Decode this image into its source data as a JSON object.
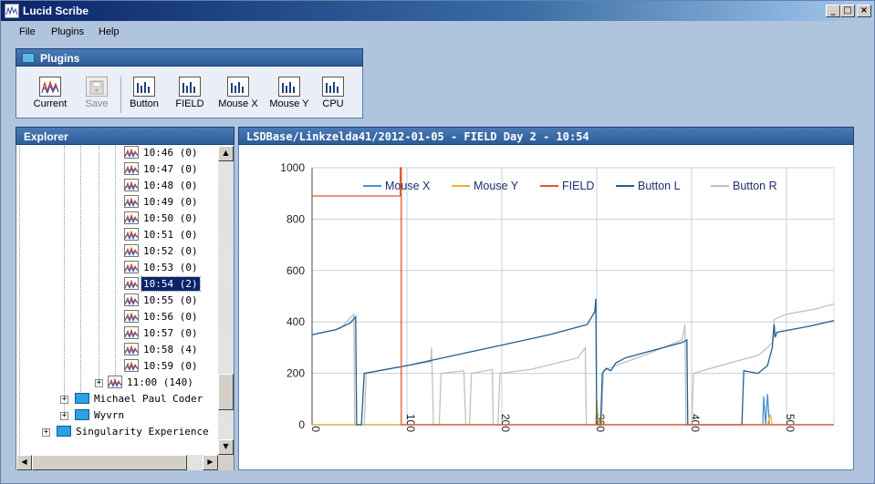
{
  "window": {
    "title": "Lucid Scribe"
  },
  "menu": [
    {
      "label": "File"
    },
    {
      "label": "Plugins"
    },
    {
      "label": "Help"
    }
  ],
  "plugins_panel": {
    "title": "Plugins",
    "buttons": [
      {
        "label": "Current",
        "icon": "waveform-icon",
        "enabled": true
      },
      {
        "label": "Save",
        "icon": "save-disk-icon",
        "enabled": false
      },
      {
        "label": "Button",
        "icon": "signal-bars-icon",
        "enabled": true
      },
      {
        "label": "FIELD",
        "icon": "signal-bars-icon",
        "enabled": true
      },
      {
        "label": "Mouse X",
        "icon": "signal-bars-icon",
        "enabled": true
      },
      {
        "label": "Mouse Y",
        "icon": "signal-bars-icon",
        "enabled": true
      },
      {
        "label": "CPU",
        "icon": "signal-bars-icon",
        "enabled": true
      }
    ]
  },
  "explorer": {
    "title": "Explorer",
    "items": [
      {
        "label": "10:46 (0)",
        "type": "session"
      },
      {
        "label": "10:47 (0)",
        "type": "session"
      },
      {
        "label": "10:48 (0)",
        "type": "session"
      },
      {
        "label": "10:49 (0)",
        "type": "session"
      },
      {
        "label": "10:50 (0)",
        "type": "session"
      },
      {
        "label": "10:51 (0)",
        "type": "session"
      },
      {
        "label": "10:52 (0)",
        "type": "session"
      },
      {
        "label": "10:53 (0)",
        "type": "session"
      },
      {
        "label": "10:54 (2)",
        "type": "session",
        "selected": true
      },
      {
        "label": "10:55 (0)",
        "type": "session"
      },
      {
        "label": "10:56 (0)",
        "type": "session"
      },
      {
        "label": "10:57 (0)",
        "type": "session"
      },
      {
        "label": "10:58 (4)",
        "type": "session"
      },
      {
        "label": "10:59 (0)",
        "type": "session"
      },
      {
        "label": "11:00 (140)",
        "type": "session-collapsed"
      },
      {
        "label": "Michael Paul Coder",
        "type": "folder"
      },
      {
        "label": "Wyvrn",
        "type": "folder"
      },
      {
        "label": "Singularity Experience",
        "type": "root-folder"
      }
    ]
  },
  "chart_panel": {
    "title": "LSDBase/Linkzelda41/2012-01-05 - FIELD Day 2 - 10:54"
  },
  "colors": {
    "mouse_x": "#4a8fd6",
    "mouse_y": "#f0b030",
    "field": "#e8542a",
    "button_l": "#1f5f96",
    "button_r": "#c0c0c0"
  },
  "chart_data": {
    "type": "line",
    "xlim": [
      0,
      550
    ],
    "ylim": [
      0,
      1000
    ],
    "xticks": [
      0,
      100,
      200,
      300,
      400,
      500
    ],
    "yticks": [
      0,
      200,
      400,
      600,
      800,
      1000
    ],
    "grid": true,
    "legend_position": "top",
    "series": [
      {
        "name": "Mouse X",
        "color": "#4a8fd6",
        "points": [
          [
            0,
            0
          ],
          [
            475,
            0
          ],
          [
            476,
            110
          ],
          [
            478,
            0
          ],
          [
            480,
            120
          ],
          [
            482,
            0
          ],
          [
            550,
            0
          ]
        ]
      },
      {
        "name": "Mouse Y",
        "color": "#f0b030",
        "points": [
          [
            0,
            0
          ],
          [
            299,
            0
          ],
          [
            300,
            100
          ],
          [
            302,
            0
          ],
          [
            305,
            30
          ],
          [
            306,
            0
          ],
          [
            480,
            0
          ],
          [
            483,
            40
          ],
          [
            485,
            0
          ],
          [
            550,
            0
          ]
        ]
      },
      {
        "name": "FIELD",
        "color": "#e8542a",
        "points": [
          [
            0,
            890
          ],
          [
            93,
            890
          ],
          [
            93,
            1000
          ],
          [
            94,
            1000
          ],
          [
            94,
            0
          ],
          [
            550,
            0
          ]
        ]
      },
      {
        "name": "Button L",
        "color": "#1f5f96",
        "points": [
          [
            0,
            350
          ],
          [
            25,
            370
          ],
          [
            40,
            395
          ],
          [
            46,
            420
          ],
          [
            47,
            0
          ],
          [
            52,
            0
          ],
          [
            55,
            200
          ],
          [
            100,
            230
          ],
          [
            150,
            270
          ],
          [
            200,
            310
          ],
          [
            250,
            350
          ],
          [
            290,
            390
          ],
          [
            298,
            440
          ],
          [
            299,
            490
          ],
          [
            300,
            0
          ],
          [
            304,
            0
          ],
          [
            306,
            200
          ],
          [
            310,
            220
          ],
          [
            315,
            210
          ],
          [
            320,
            240
          ],
          [
            330,
            260
          ],
          [
            350,
            280
          ],
          [
            380,
            310
          ],
          [
            390,
            320
          ],
          [
            395,
            330
          ],
          [
            396,
            0
          ],
          [
            453,
            0
          ],
          [
            455,
            210
          ],
          [
            470,
            200
          ],
          [
            480,
            230
          ],
          [
            485,
            300
          ],
          [
            487,
            390
          ],
          [
            488,
            340
          ],
          [
            490,
            360
          ],
          [
            520,
            380
          ],
          [
            550,
            405
          ]
        ]
      },
      {
        "name": "Button R",
        "color": "#c0c0c0",
        "points": [
          [
            0,
            350
          ],
          [
            30,
            375
          ],
          [
            44,
            430
          ],
          [
            45,
            0
          ],
          [
            55,
            0
          ],
          [
            57,
            200
          ],
          [
            100,
            230
          ],
          [
            125,
            245
          ],
          [
            126,
            300
          ],
          [
            128,
            0
          ],
          [
            134,
            0
          ],
          [
            136,
            200
          ],
          [
            160,
            210
          ],
          [
            162,
            0
          ],
          [
            166,
            0
          ],
          [
            168,
            200
          ],
          [
            190,
            215
          ],
          [
            191,
            0
          ],
          [
            196,
            0
          ],
          [
            198,
            200
          ],
          [
            230,
            215
          ],
          [
            280,
            260
          ],
          [
            288,
            300
          ],
          [
            289,
            0
          ],
          [
            305,
            0
          ],
          [
            307,
            210
          ],
          [
            320,
            230
          ],
          [
            350,
            270
          ],
          [
            390,
            330
          ],
          [
            393,
            390
          ],
          [
            394,
            0
          ],
          [
            400,
            0
          ],
          [
            402,
            200
          ],
          [
            440,
            240
          ],
          [
            470,
            270
          ],
          [
            480,
            300
          ],
          [
            485,
            320
          ],
          [
            487,
            410
          ],
          [
            500,
            430
          ],
          [
            530,
            450
          ],
          [
            550,
            470
          ]
        ]
      }
    ]
  }
}
